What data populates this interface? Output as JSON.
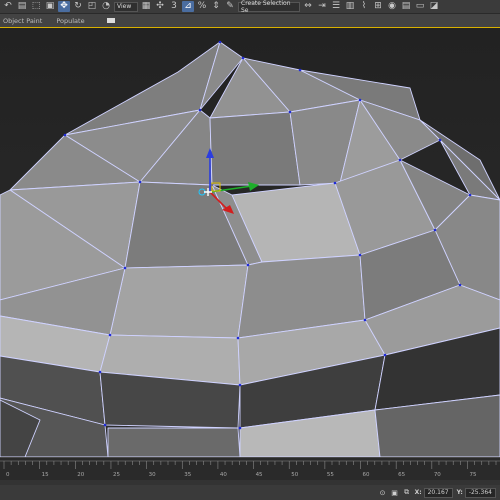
{
  "toolbar": {
    "reference_coordinate_system": "View",
    "selection_set_placeholder": "Create Selection Se"
  },
  "ribbon": {
    "tabs": [
      "Object Paint",
      "Populate"
    ]
  },
  "timeline": {
    "ticks": [
      "0",
      "15",
      "20",
      "25",
      "30",
      "35",
      "40",
      "45",
      "50",
      "55",
      "60",
      "65",
      "70",
      "75"
    ]
  },
  "status": {
    "x_label": "X:",
    "x_value": "20.167",
    "y_label": "Y:",
    "y_value": "-25.364"
  }
}
